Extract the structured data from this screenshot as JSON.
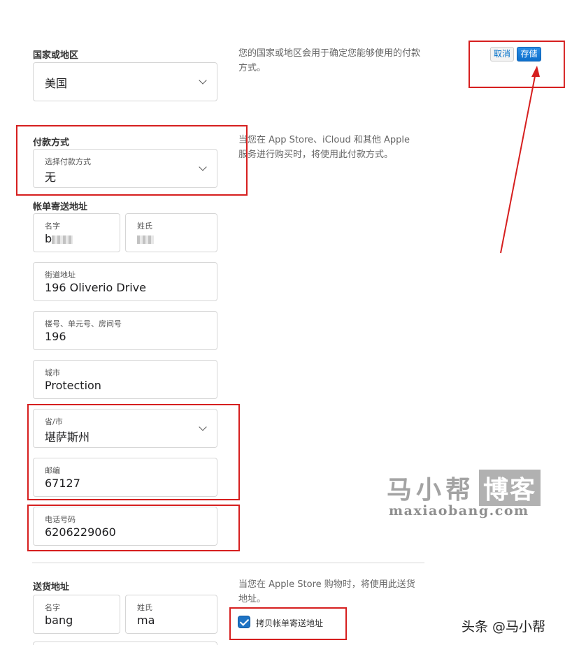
{
  "header": {
    "cancel_label": "取消",
    "save_label": "存储"
  },
  "country": {
    "section_label": "国家或地区",
    "value": "美国",
    "description": "您的国家或地区会用于确定您能够使用的付款方式。"
  },
  "payment": {
    "section_label": "付款方式",
    "field_label": "选择付款方式",
    "value": "无",
    "description": "当您在 App Store、iCloud 和其他 Apple 服务进行购买时，将使用此付款方式。"
  },
  "billing": {
    "section_label": "帐单寄送地址",
    "first_name": {
      "label": "名字",
      "value": "b"
    },
    "last_name": {
      "label": "姓氏",
      "value": ""
    },
    "street": {
      "label": "街道地址",
      "value": "196 Oliverio Drive"
    },
    "unit": {
      "label": "楼号、单元号、房间号",
      "value": "196"
    },
    "city": {
      "label": "城市",
      "value": "Protection"
    },
    "state": {
      "label": "省/市",
      "value": "堪萨斯州"
    },
    "zip": {
      "label": "邮编",
      "value": "67127"
    },
    "phone": {
      "label": "电话号码",
      "value": "6206229060"
    }
  },
  "shipping": {
    "section_label": "送货地址",
    "description": "当您在 Apple Store 购物时，将使用此送货地址。",
    "first_name": {
      "label": "名字",
      "value": "bang"
    },
    "last_name": {
      "label": "姓氏",
      "value": "ma"
    },
    "copy_checkbox_label": "拷贝帐单寄送地址",
    "copy_checked": true
  },
  "watermark": {
    "brand": "马小帮",
    "brand_tag": "博客",
    "url": "maxiaobang.com",
    "credit": "头条 @马小帮"
  },
  "colors": {
    "accent": "#0d6fcb",
    "annotation": "#d61f1f"
  }
}
